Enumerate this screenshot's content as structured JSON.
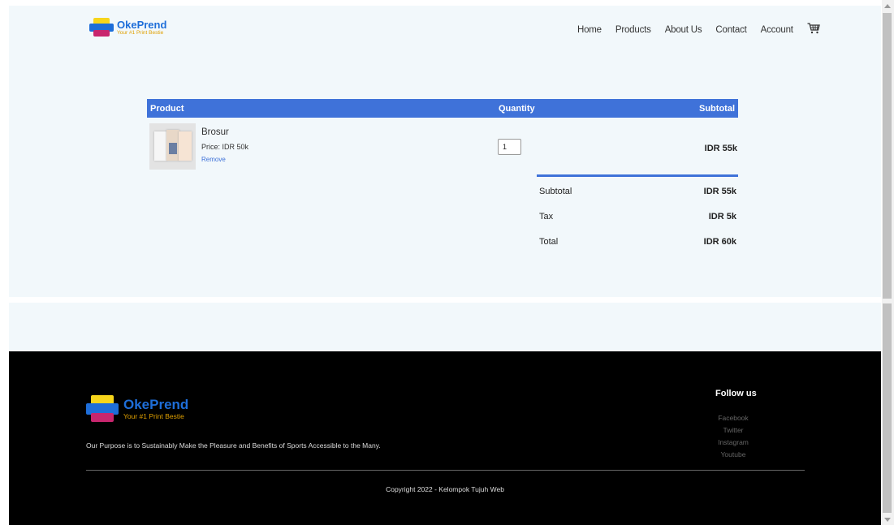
{
  "brand": {
    "name": "OkePrend",
    "tagline": "Your #1 Print Bestie"
  },
  "nav": {
    "items": [
      "Home",
      "Products",
      "About Us",
      "Contact",
      "Account"
    ],
    "cart_icon": "cart-icon"
  },
  "cart": {
    "headers": {
      "product": "Product",
      "quantity": "Quantity",
      "subtotal": "Subtotal"
    },
    "items": [
      {
        "name": "Brosur",
        "price": "Price: IDR 50k",
        "remove_label": "Remove",
        "quantity": "1",
        "subtotal": "IDR 55k"
      }
    ],
    "summary": [
      {
        "label": "Subtotal",
        "value": "IDR 55k"
      },
      {
        "label": "Tax",
        "value": "IDR 5k"
      },
      {
        "label": "Total",
        "value": "IDR 60k"
      }
    ]
  },
  "footer": {
    "purpose": "Our Purpose is to Sustainably Make the Pleasure and Benefits of Sports Accessible to the Many.",
    "follow_title": "Follow us",
    "social": [
      "Facebook",
      "Twitter",
      "Instagram",
      "Youtube"
    ],
    "copyright": "Copyright 2022 - Kelompok Tujuh Web"
  },
  "colors": {
    "accent": "#3f72d9",
    "brand_blue": "#1e6ed9",
    "brand_yellow": "#f7d51b",
    "brand_magenta": "#c8266e",
    "footer_bg": "#000000"
  }
}
